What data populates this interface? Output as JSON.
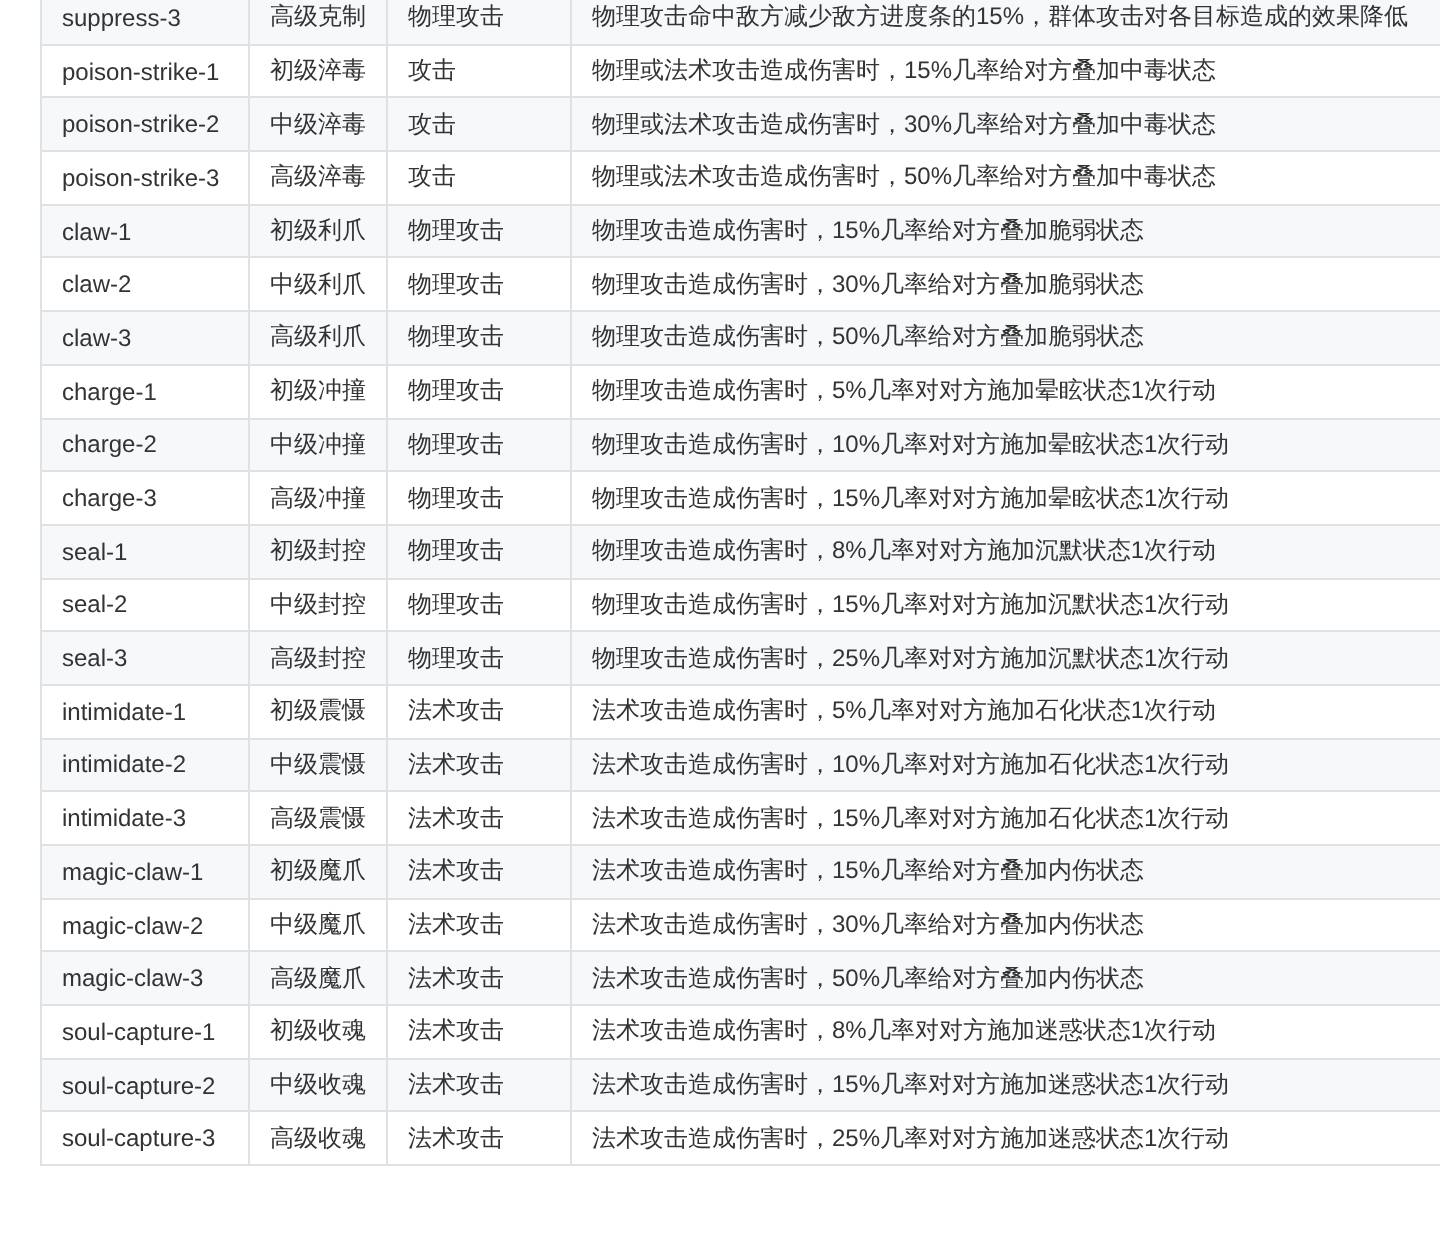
{
  "table": {
    "rows": [
      {
        "cells": [
          "suppress-3",
          "高级克制",
          "物理攻击",
          "物理攻击命中敌方减少敌方进度条的15%，群体攻击对各目标造成的效果降低"
        ]
      },
      {
        "cells": [
          "poison-strike-1",
          "初级淬毒",
          "攻击",
          "物理或法术攻击造成伤害时，15%几率给对方叠加中毒状态"
        ]
      },
      {
        "cells": [
          "poison-strike-2",
          "中级淬毒",
          "攻击",
          "物理或法术攻击造成伤害时，30%几率给对方叠加中毒状态"
        ]
      },
      {
        "cells": [
          "poison-strike-3",
          "高级淬毒",
          "攻击",
          "物理或法术攻击造成伤害时，50%几率给对方叠加中毒状态"
        ]
      },
      {
        "cells": [
          "claw-1",
          "初级利爪",
          "物理攻击",
          "物理攻击造成伤害时，15%几率给对方叠加脆弱状态"
        ]
      },
      {
        "cells": [
          "claw-2",
          "中级利爪",
          "物理攻击",
          "物理攻击造成伤害时，30%几率给对方叠加脆弱状态"
        ]
      },
      {
        "cells": [
          "claw-3",
          "高级利爪",
          "物理攻击",
          "物理攻击造成伤害时，50%几率给对方叠加脆弱状态"
        ]
      },
      {
        "cells": [
          "charge-1",
          "初级冲撞",
          "物理攻击",
          "物理攻击造成伤害时，5%几率对对方施加晕眩状态1次行动"
        ]
      },
      {
        "cells": [
          "charge-2",
          "中级冲撞",
          "物理攻击",
          "物理攻击造成伤害时，10%几率对对方施加晕眩状态1次行动"
        ]
      },
      {
        "cells": [
          "charge-3",
          "高级冲撞",
          "物理攻击",
          "物理攻击造成伤害时，15%几率对对方施加晕眩状态1次行动"
        ]
      },
      {
        "cells": [
          "seal-1",
          "初级封控",
          "物理攻击",
          "物理攻击造成伤害时，8%几率对对方施加沉默状态1次行动"
        ]
      },
      {
        "cells": [
          "seal-2",
          "中级封控",
          "物理攻击",
          "物理攻击造成伤害时，15%几率对对方施加沉默状态1次行动"
        ]
      },
      {
        "cells": [
          "seal-3",
          "高级封控",
          "物理攻击",
          "物理攻击造成伤害时，25%几率对对方施加沉默状态1次行动"
        ]
      },
      {
        "cells": [
          "intimidate-1",
          "初级震慑",
          "法术攻击",
          "法术攻击造成伤害时，5%几率对对方施加石化状态1次行动"
        ]
      },
      {
        "cells": [
          "intimidate-2",
          "中级震慑",
          "法术攻击",
          "法术攻击造成伤害时，10%几率对对方施加石化状态1次行动"
        ]
      },
      {
        "cells": [
          "intimidate-3",
          "高级震慑",
          "法术攻击",
          "法术攻击造成伤害时，15%几率对对方施加石化状态1次行动"
        ]
      },
      {
        "cells": [
          "magic-claw-1",
          "初级魔爪",
          "法术攻击",
          "法术攻击造成伤害时，15%几率给对方叠加内伤状态"
        ]
      },
      {
        "cells": [
          "magic-claw-2",
          "中级魔爪",
          "法术攻击",
          "法术攻击造成伤害时，30%几率给对方叠加内伤状态"
        ]
      },
      {
        "cells": [
          "magic-claw-3",
          "高级魔爪",
          "法术攻击",
          "法术攻击造成伤害时，50%几率给对方叠加内伤状态"
        ]
      },
      {
        "cells": [
          "soul-capture-1",
          "初级收魂",
          "法术攻击",
          "法术攻击造成伤害时，8%几率对对方施加迷惑状态1次行动"
        ]
      },
      {
        "cells": [
          "soul-capture-2",
          "中级收魂",
          "法术攻击",
          "法术攻击造成伤害时，15%几率对对方施加迷惑状态1次行动"
        ]
      },
      {
        "cells": [
          "soul-capture-3",
          "高级收魂",
          "法术攻击",
          "法术攻击造成伤害时，25%几率对对方施加迷惑状态1次行动"
        ]
      }
    ]
  }
}
